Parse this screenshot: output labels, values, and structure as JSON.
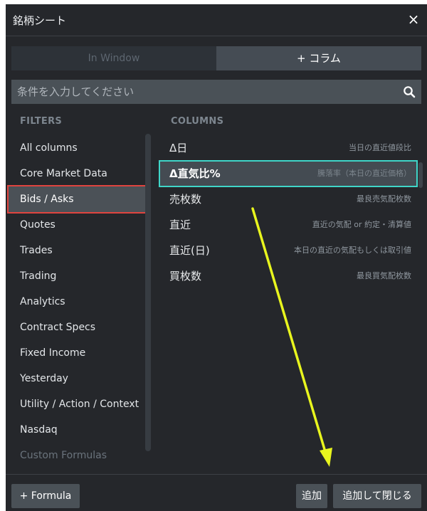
{
  "window": {
    "title": "銘柄シート",
    "close_symbol": "×"
  },
  "tabs": [
    {
      "label": "In Window"
    },
    {
      "label": "+ コラム"
    }
  ],
  "search": {
    "placeholder": "条件を入力してください"
  },
  "filters_header": "FILTERS",
  "columns_header": "COLUMNS",
  "filters": [
    {
      "label": "All columns"
    },
    {
      "label": "Core Market Data"
    },
    {
      "label": "Bids / Asks",
      "selected": true
    },
    {
      "label": "Quotes"
    },
    {
      "label": "Trades"
    },
    {
      "label": "Trading"
    },
    {
      "label": "Analytics"
    },
    {
      "label": "Contract Specs"
    },
    {
      "label": "Fixed Income"
    },
    {
      "label": "Yesterday"
    },
    {
      "label": "Utility / Action / Context"
    },
    {
      "label": "Nasdaq"
    },
    {
      "label": "Custom Formulas",
      "faded": true
    }
  ],
  "columns": [
    {
      "name": "Δ日",
      "desc": "当日の直近値段比"
    },
    {
      "name": "Δ直気比%",
      "desc": "騰落率（本日の直近価格）",
      "selected": true
    },
    {
      "name": "売枚数",
      "desc": "最良売気配枚数"
    },
    {
      "name": "直近",
      "desc": "直近の気配 or 約定・清算値"
    },
    {
      "name": "直近(日)",
      "desc": "本日の直近の気配もしくは取引値"
    },
    {
      "name": "買枚数",
      "desc": "最良買気配枚数"
    }
  ],
  "footer": {
    "formula_label": "+ Formula",
    "add_label": "追加",
    "add_close_label": "追加して閉じる"
  },
  "colors": {
    "panel_bg": "#25272b",
    "selected_filter_outline": "#e0443f",
    "selected_column_outline": "#3fd6c8",
    "annotation_arrow": "#e8f51e"
  },
  "icons": [
    "close-icon",
    "search-icon",
    "annotation-arrow"
  ]
}
